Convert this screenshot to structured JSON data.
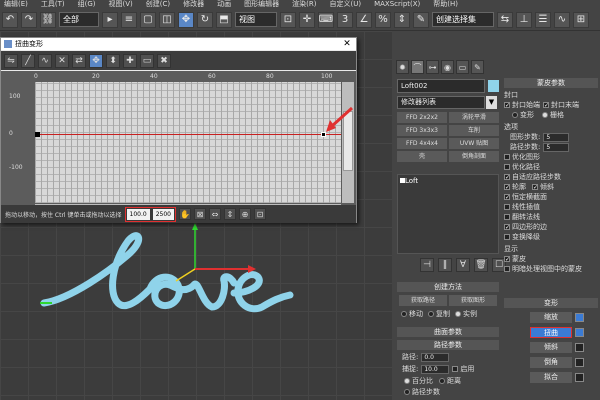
{
  "menubar": [
    "编辑(E)",
    "工具(T)",
    "组(G)",
    "视图(V)",
    "创建(C)",
    "修改器",
    "动画",
    "图形编辑器",
    "渲染(R)",
    "自定义(U)",
    "MAXScript(X)",
    "帮助(H)"
  ],
  "toolbar": {
    "filter": "全部",
    "view": "视图",
    "selection_set": "创建选择集"
  },
  "dialog": {
    "title": "扭曲变形",
    "y_ticks": [
      "100",
      "0",
      "-100"
    ],
    "x_ticks": [
      "0",
      "20",
      "40",
      "60",
      "80",
      "100"
    ],
    "status_text": "拖动以移动，按住 Ctrl 键单击或拖动以选择",
    "value1": "100.0",
    "value2": "2500"
  },
  "viewport": {
    "curve_text": "love"
  },
  "panel": {
    "object_name": "Loft002",
    "modifier_list": "修改器列表",
    "mod_buttons": [
      "FFD 2x2x2",
      "涡轮平滑",
      "FFD 3x3x3",
      "车削",
      "FFD 4x4x4",
      "UVW 贴图",
      "壳",
      "倒角剖面"
    ],
    "stack_item": "Loft",
    "skin_params": "蒙皮参数",
    "capping": "封口",
    "cap_start": "封口始端",
    "cap_end": "封口末端",
    "morph": "变形",
    "grid": "栅格",
    "options": "选项",
    "shape_steps_label": "图形步数:",
    "shape_steps": "5",
    "path_steps_label": "路径步数:",
    "path_steps": "5",
    "optimize_shapes": "优化图形",
    "optimize_path": "优化路径",
    "adaptive_path": "自适应路径步数",
    "contour": "轮廓",
    "banking": "倾斜",
    "constant_cross": "恒定横截面",
    "linear_interp": "线性插值",
    "flip_normals": "翻转法线",
    "quad_sides": "四边形的边",
    "transform_degrade": "变换降级",
    "display": "显示",
    "skin": "蒙皮",
    "skin_shaded": "明暗处理视图中的蒙皮",
    "creation_method": "创建方法",
    "get_path": "获取路径",
    "get_shape": "获取图形",
    "move": "移动",
    "copy": "复制",
    "instance": "实例",
    "surface_params": "曲面参数",
    "path_params": "路径参数",
    "path_label": "路径:",
    "path_value": "0.0",
    "snap_label": "捕捉:",
    "snap_value": "10.0",
    "enable": "启用",
    "percent": "百分比",
    "distance": "距离",
    "path_steps_opt": "路径步数",
    "deform": "变形",
    "deform_buttons": [
      "缩放",
      "扭曲",
      "倾斜",
      "倒角",
      "拟合"
    ]
  },
  "colors": {
    "accent": "#3b7bd4",
    "curve": "#8fd3ea",
    "highlight": "#e03030"
  }
}
